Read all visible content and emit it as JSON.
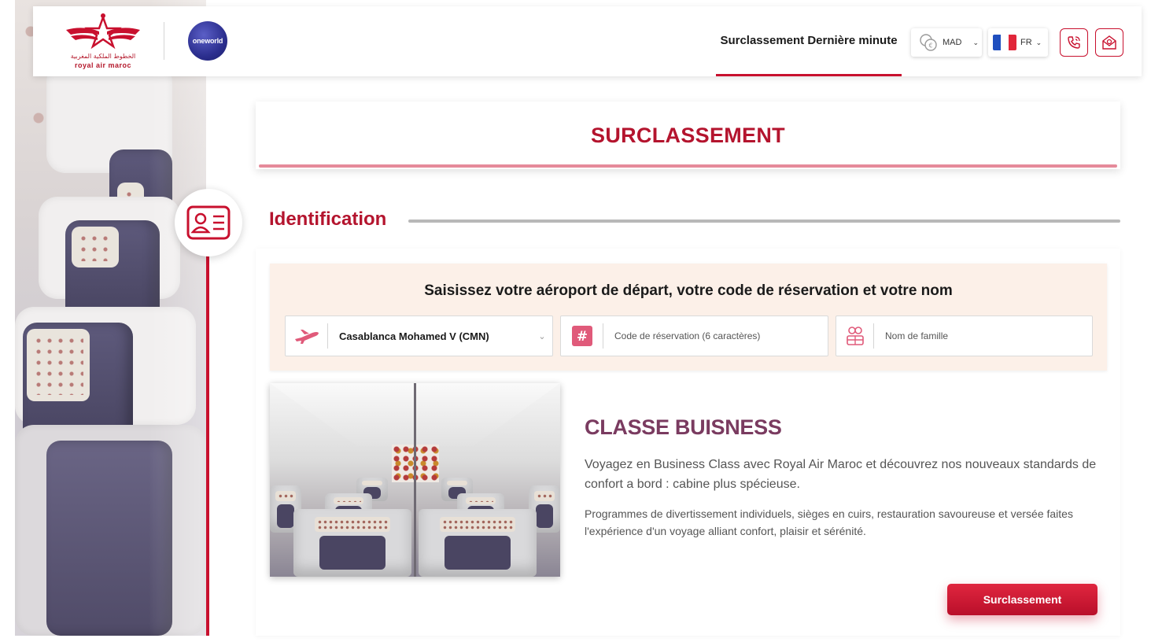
{
  "header": {
    "brand_ar": "الخطوط الملكية المغربية",
    "brand_en": "royal air maroc",
    "alliance": "oneworld",
    "nav_link": "Surclassement Dernière minute",
    "currency": "MAD",
    "language": "FR",
    "flag_colors": [
      "#1f4fbf",
      "#ffffff",
      "#e1263a"
    ]
  },
  "page": {
    "title": "SURCLASSEMENT",
    "section_title": "Identification"
  },
  "search": {
    "heading": "Saisissez votre aéroport de départ, votre code de réservation et votre nom",
    "airport_value": "Casablanca Mohamed V (CMN)",
    "booking_placeholder": "Code de réservation (6 caractères)",
    "lastname_placeholder": "Nom de famille"
  },
  "business": {
    "title": "CLASSE BUISNESS",
    "paragraph1": "Voyagez en Business Class avec Royal Air Maroc et découvrez nos nouveaux standards de confort a bord : cabine plus spécieuse.",
    "paragraph2": "Programmes de divertissement individuels, sièges en cuirs, restauration savoureuse et versée faites l'expérience d'un voyage alliant confort,  plaisir et sérénité.",
    "button_label": "Surclassement"
  },
  "colors": {
    "accent": "#c8102e",
    "title_red": "#b4142e",
    "business_title": "#7a3b60",
    "panel_bg": "#fcf0e8"
  }
}
